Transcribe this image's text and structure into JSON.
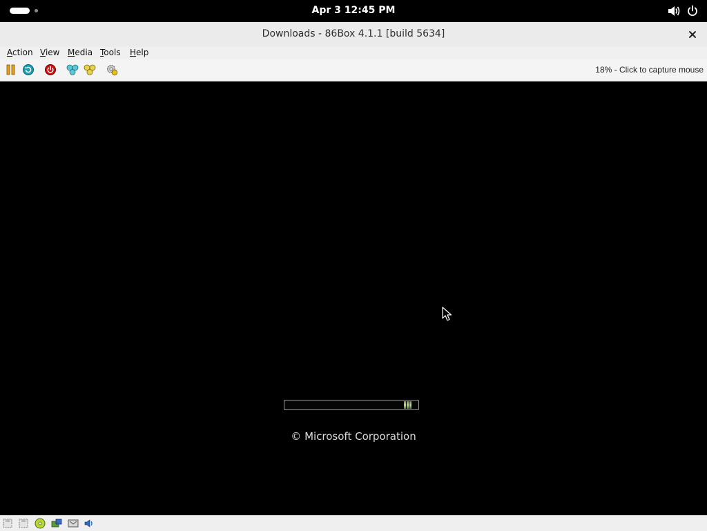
{
  "topbar": {
    "clock": "Apr 3  12:45 PM",
    "icons": [
      "activities-indicator",
      "volume-icon",
      "power-icon"
    ]
  },
  "window": {
    "title": "Downloads - 86Box 4.1.1 [build 5634]",
    "close_icon": "close-icon"
  },
  "menubar": {
    "items": [
      {
        "label": "Action",
        "underline": "A",
        "rest": "ction"
      },
      {
        "label": "View",
        "underline": "V",
        "rest": "iew"
      },
      {
        "label": "Media",
        "underline": "M",
        "rest": "edia"
      },
      {
        "label": "Tools",
        "underline": "T",
        "rest": "ools"
      },
      {
        "label": "Help",
        "underline": "H",
        "rest": "elp"
      }
    ]
  },
  "toolbar": {
    "buttons": [
      {
        "name": "pause-button",
        "icon": "pause-icon"
      },
      {
        "name": "hard-reset-button",
        "icon": "reset-icon"
      },
      {
        "name": "power-off-button",
        "icon": "power-off-icon"
      },
      {
        "name": "ctrl-alt-del-button",
        "icon": "ctrl-alt-del-icon"
      },
      {
        "name": "ctrl-alt-esc-button",
        "icon": "ctrl-alt-esc-icon"
      },
      {
        "name": "settings-button",
        "icon": "settings-gear-icon"
      }
    ],
    "status_text": "18% - Click to capture mouse"
  },
  "screen": {
    "boot_progress": 0.04,
    "copyright": "© Microsoft Corporation"
  },
  "statusbar": {
    "icons": [
      "floppy-drive-1-icon",
      "floppy-drive-2-icon",
      "cdrom-icon",
      "hard-disk-icon",
      "network-icon",
      "sound-icon"
    ]
  },
  "colors": {
    "progress_green": "#9cc24c",
    "power_red": "#d01010",
    "pause_orange": "#e0a020",
    "reset_teal": "#1aa0b0"
  }
}
